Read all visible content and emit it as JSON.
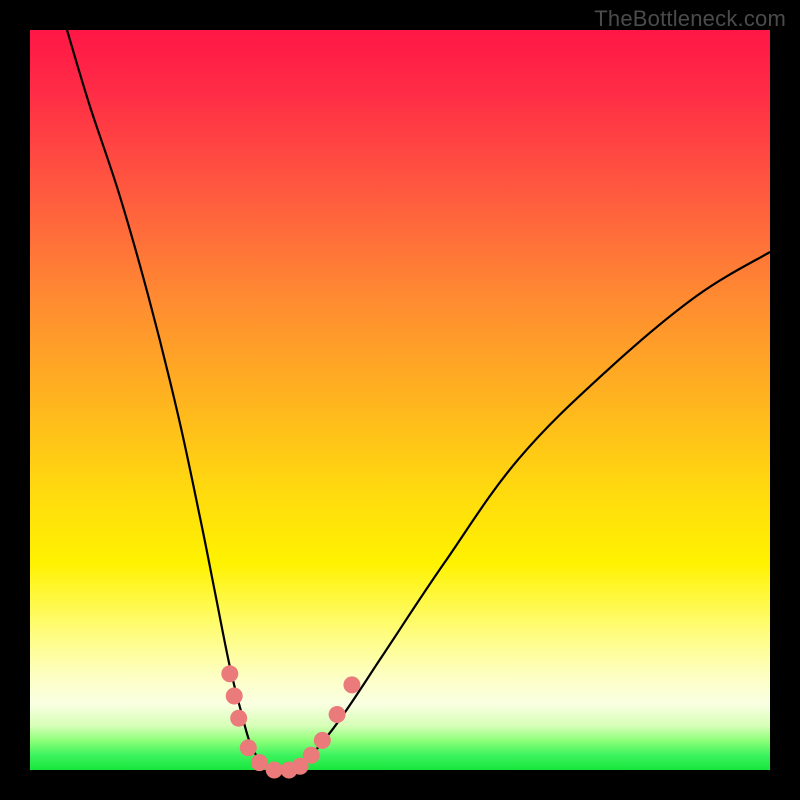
{
  "watermark": "TheBottleneck.com",
  "colors": {
    "background": "#000000",
    "gradient_top": "#ff1746",
    "gradient_mid": "#fff200",
    "gradient_bottom": "#16e63b",
    "curve": "#000000",
    "dots": "#eb7a7a"
  },
  "chart_data": {
    "type": "line",
    "title": "",
    "xlabel": "",
    "ylabel": "",
    "xlim": [
      0,
      100
    ],
    "ylim": [
      0,
      100
    ],
    "grid": false,
    "legend": false,
    "series": [
      {
        "name": "bottleneck-curve",
        "x": [
          5,
          8,
          12,
          16,
          20,
          23,
          25,
          27,
          28.5,
          30,
          32,
          34,
          36,
          38,
          42,
          48,
          56,
          66,
          78,
          90,
          100
        ],
        "y": [
          100,
          90,
          78,
          64,
          48,
          34,
          24,
          14,
          8,
          3,
          0.5,
          0,
          0.5,
          2,
          7,
          16,
          28,
          42,
          54,
          64,
          70
        ]
      }
    ],
    "markers": [
      {
        "x": 27.0,
        "y": 13.0
      },
      {
        "x": 27.6,
        "y": 10.0
      },
      {
        "x": 28.2,
        "y": 7.0
      },
      {
        "x": 29.5,
        "y": 3.0
      },
      {
        "x": 31.0,
        "y": 1.0
      },
      {
        "x": 33.0,
        "y": 0.0
      },
      {
        "x": 35.0,
        "y": 0.0
      },
      {
        "x": 36.5,
        "y": 0.5
      },
      {
        "x": 38.0,
        "y": 2.0
      },
      {
        "x": 39.5,
        "y": 4.0
      },
      {
        "x": 41.5,
        "y": 7.5
      },
      {
        "x": 43.5,
        "y": 11.5
      }
    ],
    "annotations": [
      {
        "text": "TheBottleneck.com",
        "position": "top-right"
      }
    ]
  }
}
